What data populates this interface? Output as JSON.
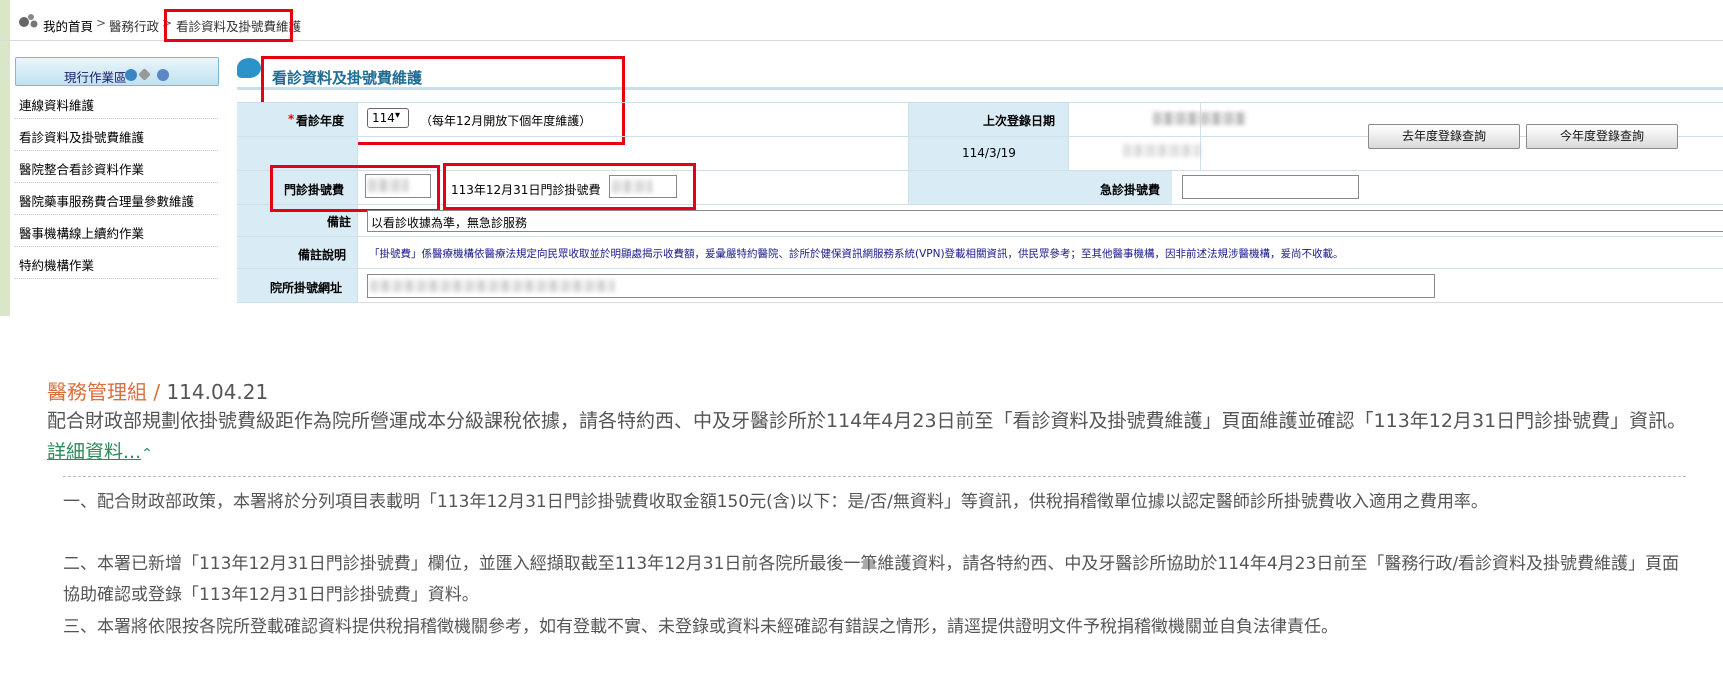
{
  "breadcrumb": {
    "home": "我的首頁",
    "sep": ">",
    "section": "醫務行政",
    "current": "看診資料及掛號費維護"
  },
  "sidebar": {
    "header": "現行作業區",
    "items": [
      {
        "label": "連線資料維護"
      },
      {
        "label": "看診資料及掛號費維護"
      },
      {
        "label": "醫院整合看診資料作業"
      },
      {
        "label": "醫院藥事服務費合理量參數維護"
      },
      {
        "label": "醫事機構線上續約作業"
      },
      {
        "label": "特約機構作業"
      }
    ]
  },
  "page": {
    "title": "看診資料及掛號費維護"
  },
  "form": {
    "year_required": "*",
    "year_label": "看診年度",
    "year_value": "114",
    "year_note": "（每年12月開放下個年度維護）",
    "last_login_label": "上次登錄日期",
    "last_login_date": "114/3/19",
    "btn_last_year": "去年度登錄查詢",
    "btn_this_year": "今年度登錄查詢",
    "outpatient_fee_label": "門診掛號費",
    "dec31_fee_label": "113年12月31日門診掛號費",
    "emergency_fee_label": "急診掛號費",
    "remark_label": "備註",
    "remark_value": "以看診收據為準，無急診服務",
    "remark_desc_label": "備註說明",
    "remark_desc_text": "「掛號費」係醫療機構依醫療法規定向民眾收取並於明顯處揭示收費額，爰彙嚴特約醫院、診所於健保資訊網服務系統(VPN)登載相關資訊，供民眾參考；至其他醫事機構，因非前述法規涉醫機構，爰尚不收載。",
    "hospital_url_label": "院所掛號網址"
  },
  "announcement": {
    "org": "醫務管理組",
    "slash": " / ",
    "date": "114.04.21",
    "summary": "配合財政部規劃依掛號費級距作為院所營運成本分級課稅依據，請各特約西、中及牙醫診所於114年4月23日前至「看診資料及掛號費維護」頁面維護並確認「113年12月31日門診掛號費」資訊。",
    "link": "詳細資料...",
    "link_icon": "chevron-up-icon",
    "p1": "一、配合財政部政策，本署將於分列項目表載明「113年12月31日門診掛號費收取金額150元(含)以下：是/否/無資料」等資訊，供稅捐稽徵單位據以認定醫師診所掛號費收入適用之費用率。",
    "p2": "二、本署已新增「113年12月31日門診掛號費」欄位，並匯入經擷取截至113年12月31日前各院所最後一筆維護資料，請各特約西、中及牙醫診所協助於114年4月23日前至「醫務行政/看診資料及掛號費維護」頁面協助確認或登錄「113年12月31日門診掛號費」資料。",
    "p3": "三、本署將依限按各院所登載確認資料提供稅捐稽徵機關參考，如有登載不實、未登錄或資料未經確認有錯誤之情形，請逕提供證明文件予稅捐稽徵機關並自負法律責任。"
  },
  "colors": {
    "label_bg": "#d9ecf5",
    "title_blue": "#1d6d96",
    "highlight_red": "#e60012",
    "org_orange": "#d9703c",
    "link_green": "#2a8a5a"
  }
}
